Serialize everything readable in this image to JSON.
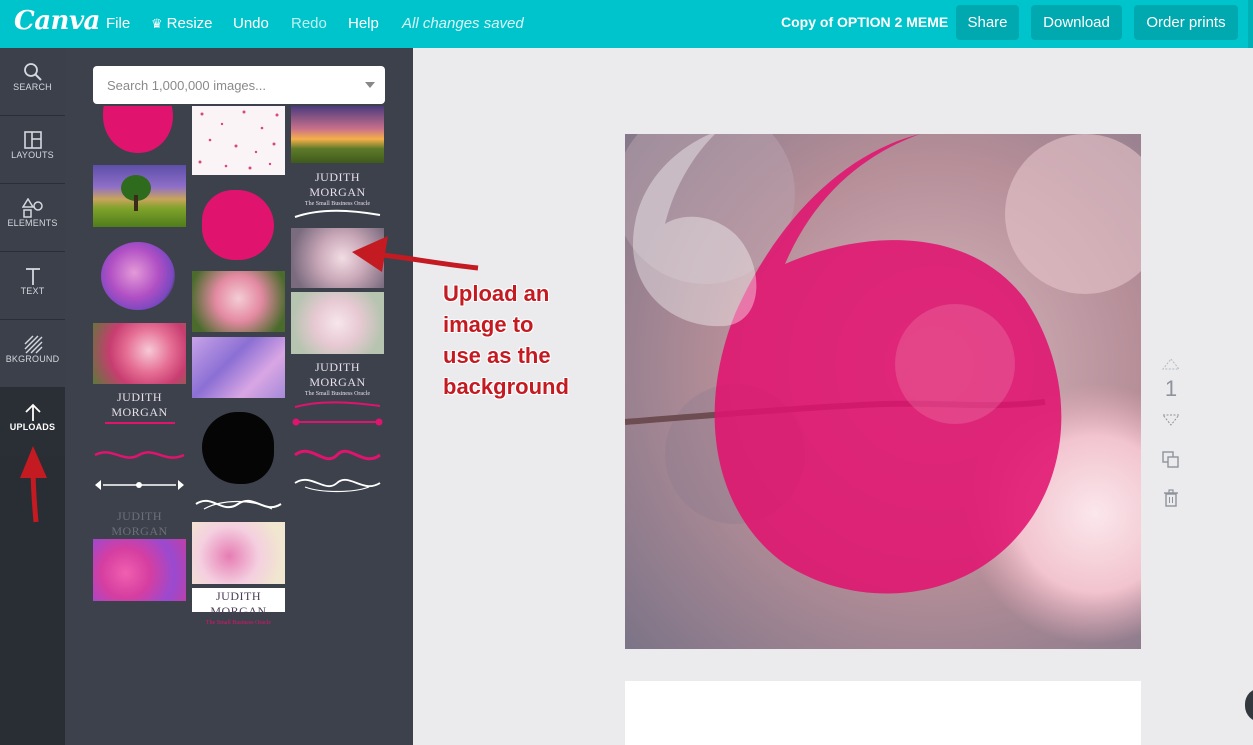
{
  "app": {
    "logo": "Canva",
    "menu": [
      "File",
      "Resize",
      "Undo",
      "Redo",
      "Help"
    ],
    "save_status": "All changes saved",
    "doc_title": "Copy of OPTION 2 MEME",
    "buttons": {
      "share": "Share",
      "download": "Download",
      "order_prints": "Order prints"
    }
  },
  "sidebar": {
    "items": [
      {
        "label": "SEARCH",
        "icon": "search-icon"
      },
      {
        "label": "LAYOUTS",
        "icon": "layouts-icon"
      },
      {
        "label": "ELEMENTS",
        "icon": "elements-icon"
      },
      {
        "label": "TEXT",
        "icon": "text-icon"
      },
      {
        "label": "BKGROUND",
        "icon": "background-icon"
      },
      {
        "label": "UPLOADS",
        "icon": "uploads-icon",
        "active": true
      }
    ]
  },
  "panel": {
    "search_placeholder": "Search 1,000,000 images...",
    "logo_name": "JUDITH MORGAN",
    "logo_tagline": "The Small Business Oracle"
  },
  "canvas": {
    "page_number": "1"
  },
  "annotation": {
    "lines": [
      "Upload an",
      "image to",
      "use as the",
      "background"
    ]
  },
  "colors": {
    "topbar": "#00c4cc",
    "topbar_button": "#00a8af",
    "rail": "#2a2e35",
    "panel": "#3c414b",
    "accent_pink": "#e0136f",
    "annotation_red": "#c41a21"
  }
}
